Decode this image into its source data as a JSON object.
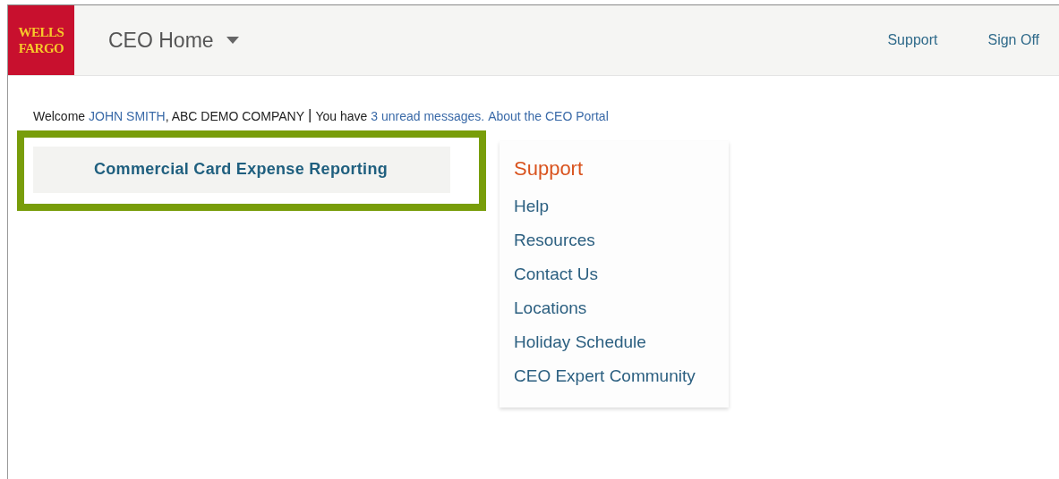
{
  "header": {
    "logo": "WELLS FARGO",
    "title": "CEO Home",
    "links": [
      "Support",
      "Sign Off"
    ]
  },
  "welcome": {
    "greeting": "Welcome",
    "user": "JOHN SMITH",
    "company": ", ABC DEMO COMPANY",
    "separator": "|",
    "prefix": "You have",
    "messages": "3 unread messages.",
    "about": "About the CEO Portal"
  },
  "services": [
    {
      "label": "Commercial Card Expense Reporting",
      "highlighted": true
    }
  ],
  "support": {
    "title": "Support",
    "links": [
      "Help",
      "Resources",
      "Contact Us",
      "Locations",
      "Holiday Schedule",
      "CEO Expert Community"
    ]
  }
}
